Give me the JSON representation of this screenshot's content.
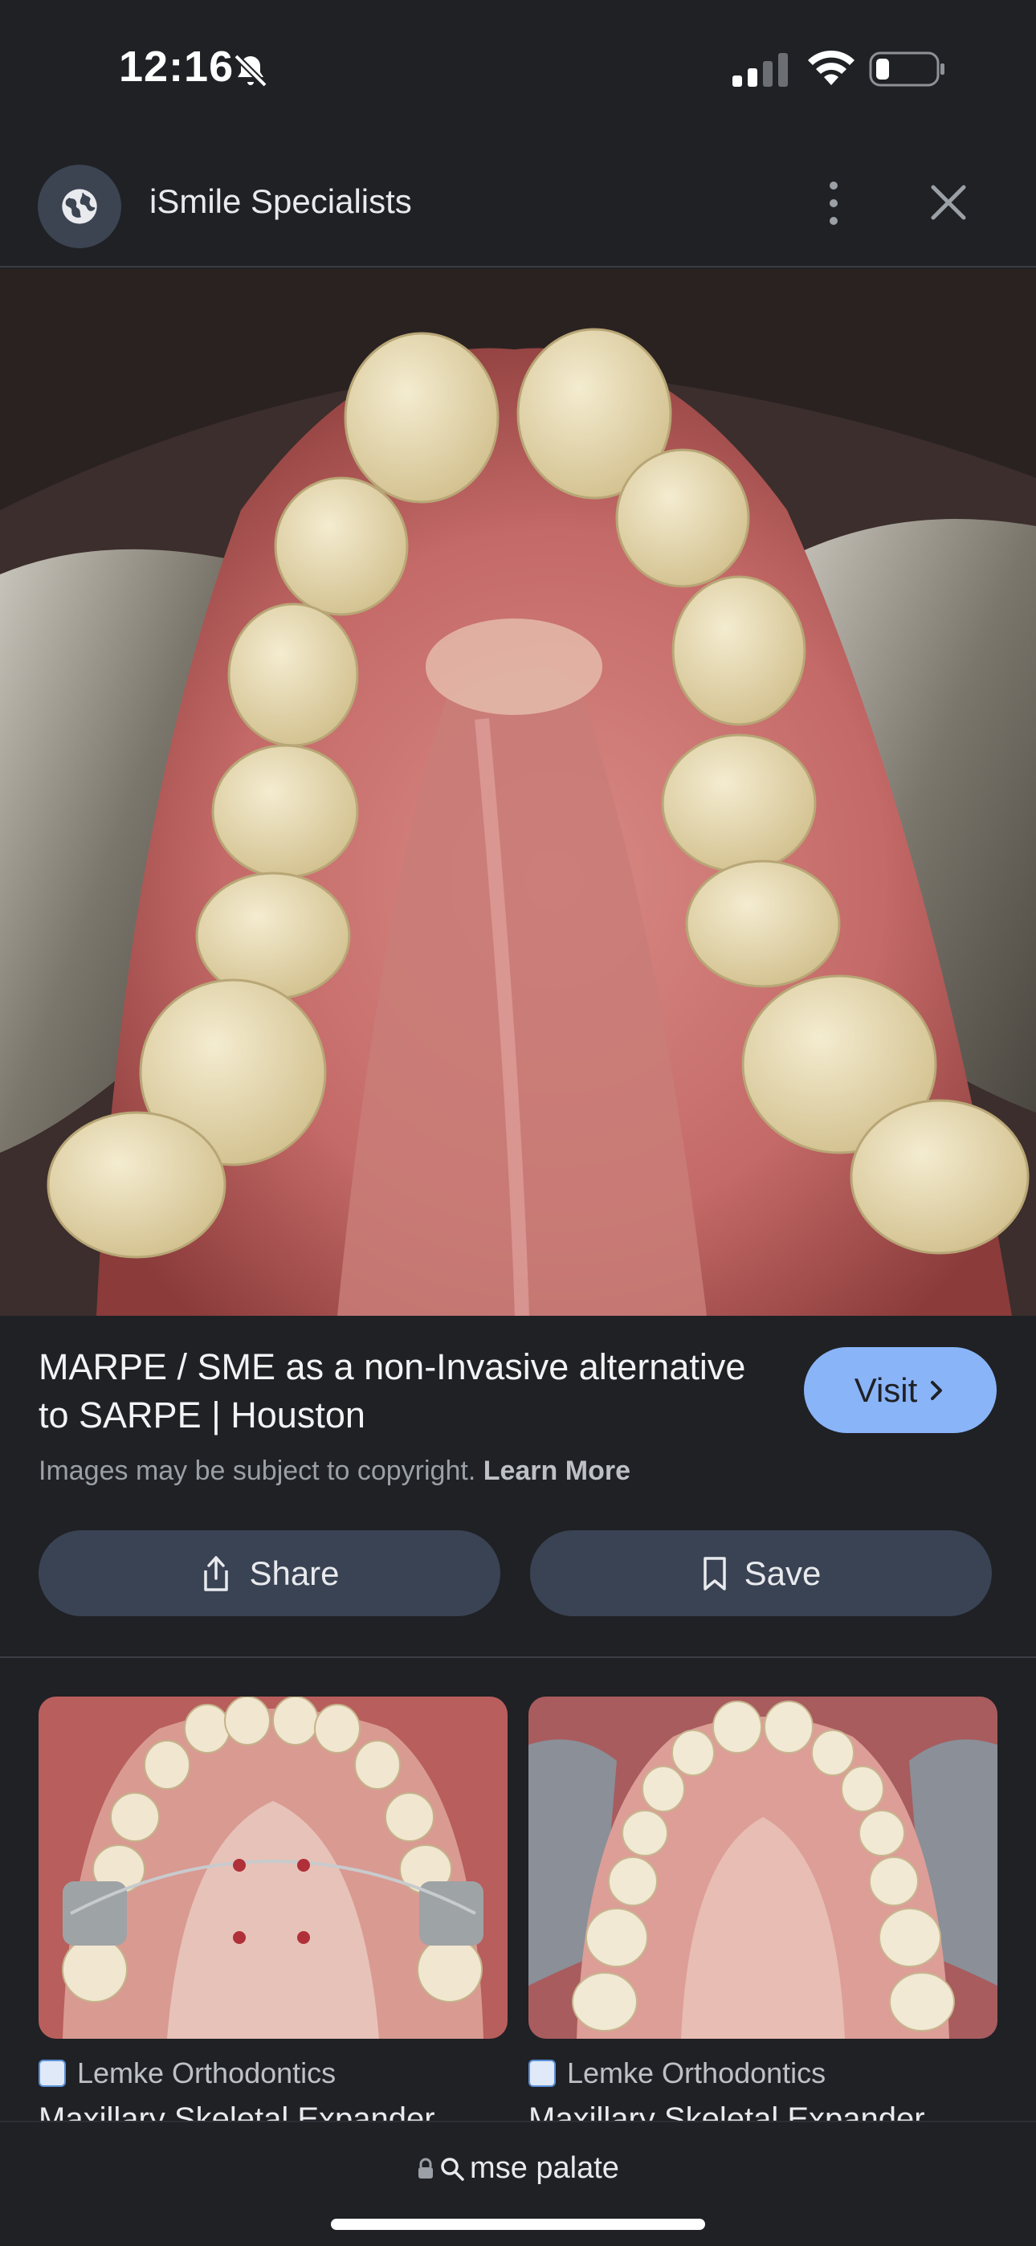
{
  "status_bar": {
    "time": "12:16",
    "icons": [
      "bell-slash-icon",
      "cellular-signal-icon",
      "wifi-icon",
      "battery-low-icon"
    ]
  },
  "header": {
    "site_icon": "globe-icon",
    "site_name": "iSmile Specialists",
    "more_icon": "more-vertical-icon",
    "close_icon": "close-icon"
  },
  "result": {
    "title": "MARPE / SME as a non-Invasive alternative to SARPE | Houston",
    "visit_label": "Visit",
    "copyright_text": "Images may be subject to copyright.",
    "learn_more": "Learn More",
    "share_label": "Share",
    "save_label": "Save"
  },
  "related": [
    {
      "source": "Lemke Orthodontics",
      "title": "Maxillary Skeletal Expander"
    },
    {
      "source": "Lemke Orthodontics",
      "title": "Maxillary Skeletal Expander"
    }
  ],
  "bottom_bar": {
    "query": "mse palate",
    "icons": [
      "lock-icon",
      "search-icon"
    ]
  },
  "colors": {
    "background": "#1f2125",
    "accent": "#8ab4f8",
    "button": "#3a4354"
  }
}
